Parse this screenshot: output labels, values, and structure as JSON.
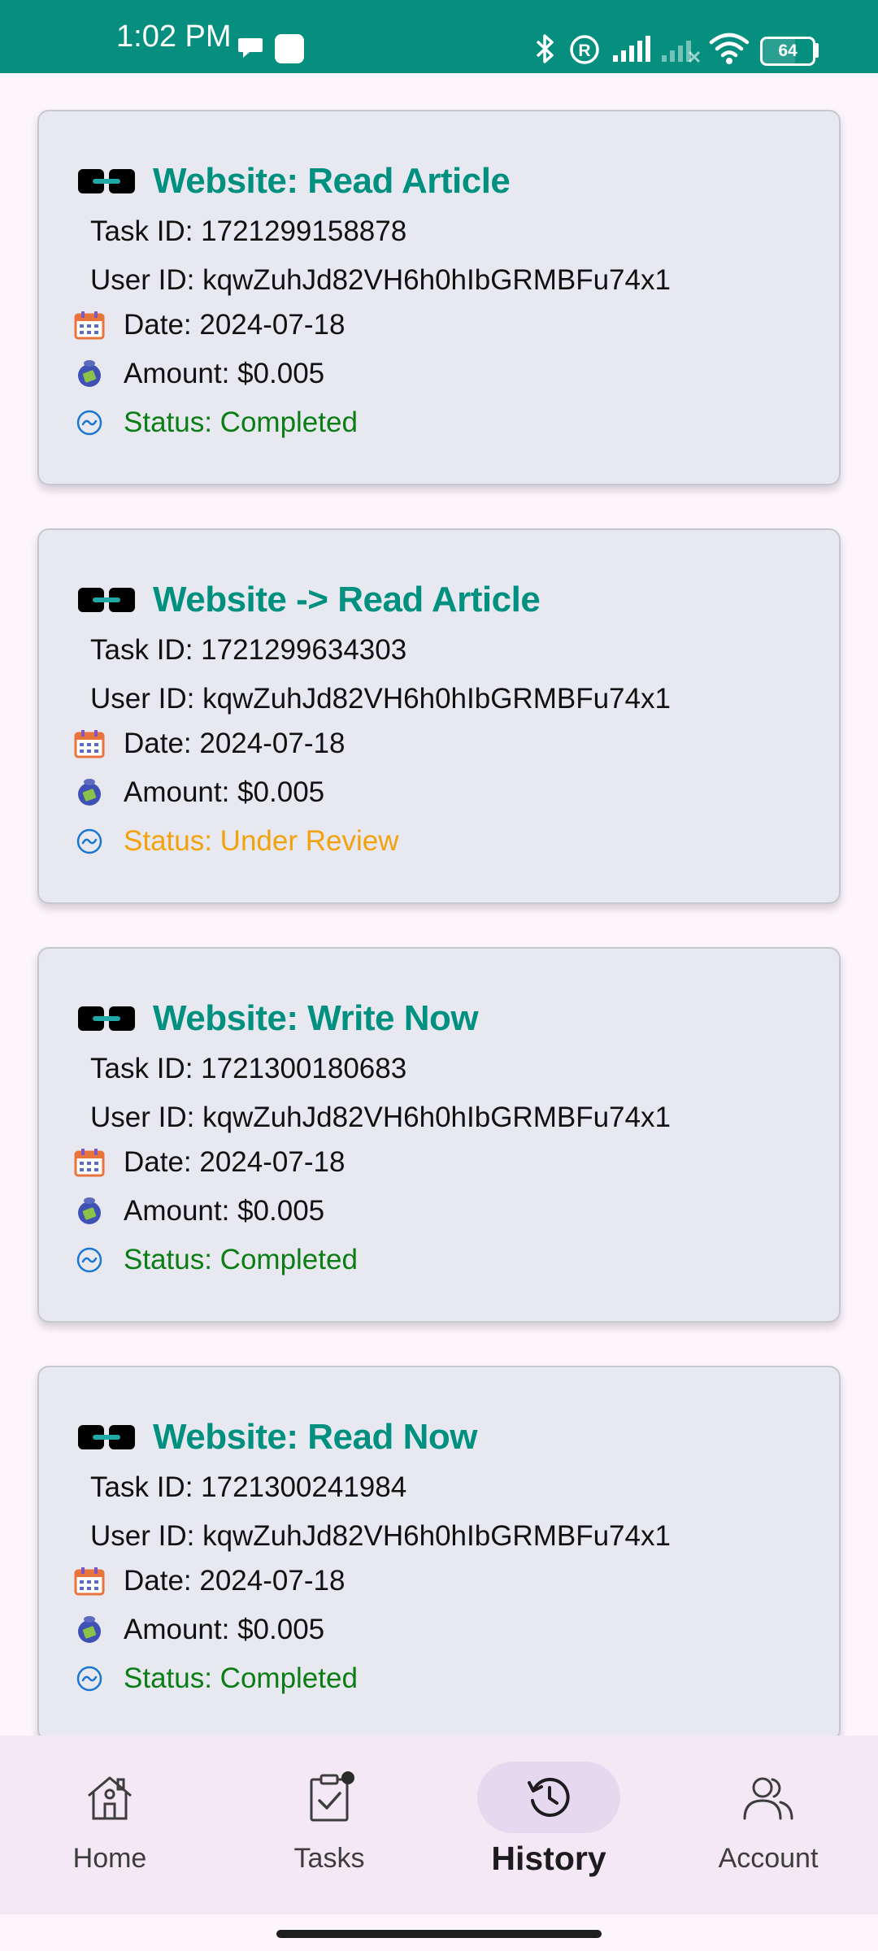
{
  "status_bar": {
    "time": "1:02 PM",
    "battery": "64",
    "battery_level_percent": 64,
    "icons": [
      "chat-bubble-icon",
      "square-notification-icon",
      "bluetooth-icon",
      "registered-icon",
      "signal-icon",
      "signal-off-icon",
      "wifi-icon",
      "battery-icon"
    ]
  },
  "cards": [
    {
      "title": "Website: Read Article",
      "task_id": "Task ID: 1721299158878",
      "user_id": "User ID: kqwZuhJd82VH6h0hIbGRMBFu74x1",
      "date": "Date: 2024-07-18",
      "amount": "Amount: $0.005",
      "status": "Status: Completed",
      "status_type": "completed"
    },
    {
      "title": "Website -> Read Article",
      "task_id": "Task ID: 1721299634303",
      "user_id": "User ID: kqwZuhJd82VH6h0hIbGRMBFu74x1",
      "date": "Date: 2024-07-18",
      "amount": "Amount: $0.005",
      "status": "Status: Under Review",
      "status_type": "review"
    },
    {
      "title": "Website: Write Now",
      "task_id": "Task ID: 1721300180683",
      "user_id": "User ID: kqwZuhJd82VH6h0hIbGRMBFu74x1",
      "date": "Date: 2024-07-18",
      "amount": "Amount: $0.005",
      "status": "Status: Completed",
      "status_type": "completed"
    },
    {
      "title": "Website: Read Now",
      "task_id": "Task ID: 1721300241984",
      "user_id": "User ID: kqwZuhJd82VH6h0hIbGRMBFu74x1",
      "date": "Date: 2024-07-18",
      "amount": "Amount: $0.005",
      "status": "Status: Completed",
      "status_type": "completed"
    }
  ],
  "nav": {
    "home": "Home",
    "tasks": "Tasks",
    "history": "History",
    "account": "Account",
    "active": "history"
  },
  "colors": {
    "accent": "#009080",
    "status_bar": "#068f7f",
    "completed": "#0a7d14",
    "under_review": "#f1a20e"
  }
}
